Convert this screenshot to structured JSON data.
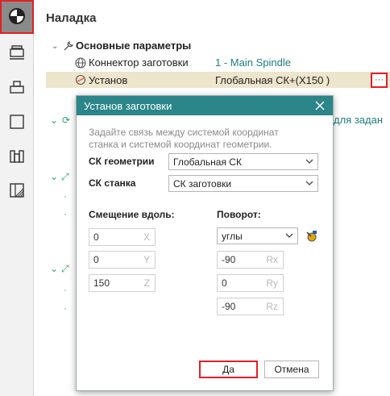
{
  "panel": {
    "title": "Наладка"
  },
  "toolbar": {
    "tools": [
      {
        "icon": "setup-icon"
      },
      {
        "icon": "stock-icon"
      },
      {
        "icon": "part-icon"
      },
      {
        "icon": "box-icon"
      },
      {
        "icon": "fixture-icon"
      },
      {
        "icon": "hatched-part-icon"
      }
    ]
  },
  "tree": {
    "group_label": "Основные параметры",
    "connector_label": "Коннектор заготовки",
    "connector_value": "1 - Main Spindle",
    "setup_label": "Установ",
    "setup_value": "Глобальная СК+(X150 )",
    "more_button": "···",
    "background_partial_text": "для задан"
  },
  "dialog": {
    "title": "Установ заготовки",
    "hint": "Задайте связь между системой координат станка и системой координат геометрии.",
    "geometry_cs_label": "СК геометрии",
    "geometry_cs_value": "Глобальная СК",
    "machine_cs_label": "СК станка",
    "machine_cs_value": "СК заготовки",
    "offset_label": "Смещение вдоль:",
    "rotation_label": "Поворот:",
    "rotation_mode": "углы",
    "offset": [
      {
        "value": "0",
        "axis": "X"
      },
      {
        "value": "0",
        "axis": "Y"
      },
      {
        "value": "150",
        "axis": "Z"
      }
    ],
    "rotation": [
      {
        "value": "-90",
        "axis": "Rx"
      },
      {
        "value": "0",
        "axis": "Ry"
      },
      {
        "value": "-90",
        "axis": "Rz"
      }
    ],
    "ok_label": "Да",
    "cancel_label": "Отмена"
  },
  "colors": {
    "accent": "#2b8589",
    "highlight": "#e21f26",
    "link": "#1e7d7e",
    "selected_row": "#ede5cc"
  }
}
